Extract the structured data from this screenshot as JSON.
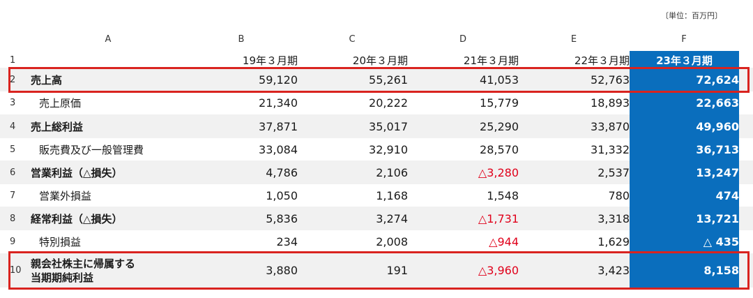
{
  "unit_note": "〔単位：百万円〕",
  "column_letters": [
    "A",
    "B",
    "C",
    "D",
    "E",
    "F"
  ],
  "header_row_number": "1",
  "periods": [
    "19年３月期",
    "20年３月期",
    "21年３月期",
    "22年３月期",
    "23年３月期"
  ],
  "rows": [
    {
      "num": "2",
      "label": "売上高",
      "values": [
        "59,120",
        "55,261",
        "41,053",
        "52,763",
        "72,624"
      ]
    },
    {
      "num": "3",
      "label": "売上原価",
      "values": [
        "21,340",
        "20,222",
        "15,779",
        "18,893",
        "22,663"
      ]
    },
    {
      "num": "4",
      "label": "売上総利益",
      "values": [
        "37,871",
        "35,017",
        "25,290",
        "33,870",
        "49,960"
      ]
    },
    {
      "num": "5",
      "label": "販売費及び一般管理費",
      "values": [
        "33,084",
        "32,910",
        "28,570",
        "31,332",
        "36,713"
      ]
    },
    {
      "num": "6",
      "label": "営業利益（△損失）",
      "values": [
        "4,786",
        "2,106",
        "△3,280",
        "2,537",
        "13,247"
      ]
    },
    {
      "num": "7",
      "label": "営業外損益",
      "values": [
        "1,050",
        "1,168",
        "1,548",
        "780",
        "474"
      ]
    },
    {
      "num": "8",
      "label": "経常利益（△損失）",
      "values": [
        "5,836",
        "3,274",
        "△1,731",
        "3,318",
        "13,721"
      ]
    },
    {
      "num": "9",
      "label": "特別損益",
      "values": [
        "234",
        "2,008",
        "△944",
        "1,629",
        "△ 435"
      ]
    },
    {
      "num": "10",
      "label_line1": "親会社株主に帰属する",
      "label_line2": "当期期純利益",
      "values": [
        "3,880",
        "191",
        "△3,960",
        "3,423",
        "8,158"
      ]
    }
  ],
  "colors": {
    "highlight_column": "#0a6ebd",
    "negative_text": "#e0001a",
    "emphasis_box": "#d9231f",
    "row_shading": "#f1f1f1"
  }
}
